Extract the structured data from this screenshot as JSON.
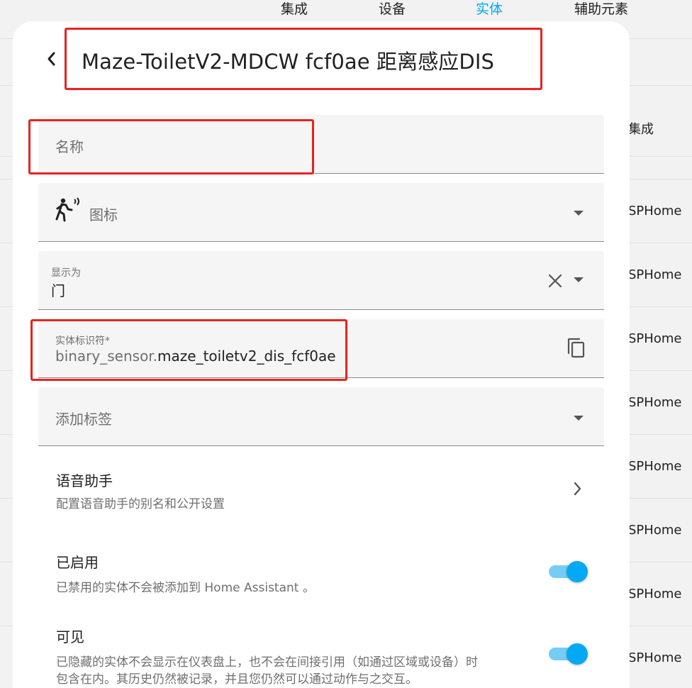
{
  "background": {
    "tabs": [
      {
        "label": "集成",
        "active": false
      },
      {
        "label": "设备",
        "active": false
      },
      {
        "label": "实体",
        "active": true
      },
      {
        "label": "辅助元素",
        "active": false
      }
    ],
    "column_header": "集成",
    "row_values": [
      "SPHome",
      "SPHome",
      "SPHome",
      "SPHome",
      "SPHome",
      "SPHome",
      "SPHome",
      "SPHome"
    ]
  },
  "dialog": {
    "title": "Maze-ToiletV2-MDCW fcf0ae 距离感应DIS",
    "back_icon": "chevron-left-icon",
    "fields": {
      "name": {
        "placeholder": "名称",
        "value": ""
      },
      "icon": {
        "label": "图标",
        "icon": "motion-sensor-icon"
      },
      "show_as": {
        "label": "显示为",
        "value": "门"
      },
      "entity_id": {
        "label": "实体标识符*",
        "prefix": "binary_sensor.",
        "value": "maze_toiletv2_dis_fcf0ae"
      },
      "labels": {
        "placeholder": "添加标签"
      }
    },
    "voice": {
      "title": "语音助手",
      "subtitle": "配置语音助手的别名和公开设置"
    },
    "enabled": {
      "title": "已启用",
      "subtitle": "已禁用的实体不会被添加到 Home Assistant 。",
      "on": true
    },
    "visible": {
      "title": "可见",
      "subtitle": "已隐藏的实体不会显示在仪表盘上，也不会在间接引用（如通过区域或设备）时",
      "subtitle2": "包含在内。其历史仍然被记录，并且您仍然可以通过动作与之交互。",
      "on": true
    }
  },
  "colors": {
    "accent": "#03a9f4",
    "highlight": "#e8231f"
  }
}
